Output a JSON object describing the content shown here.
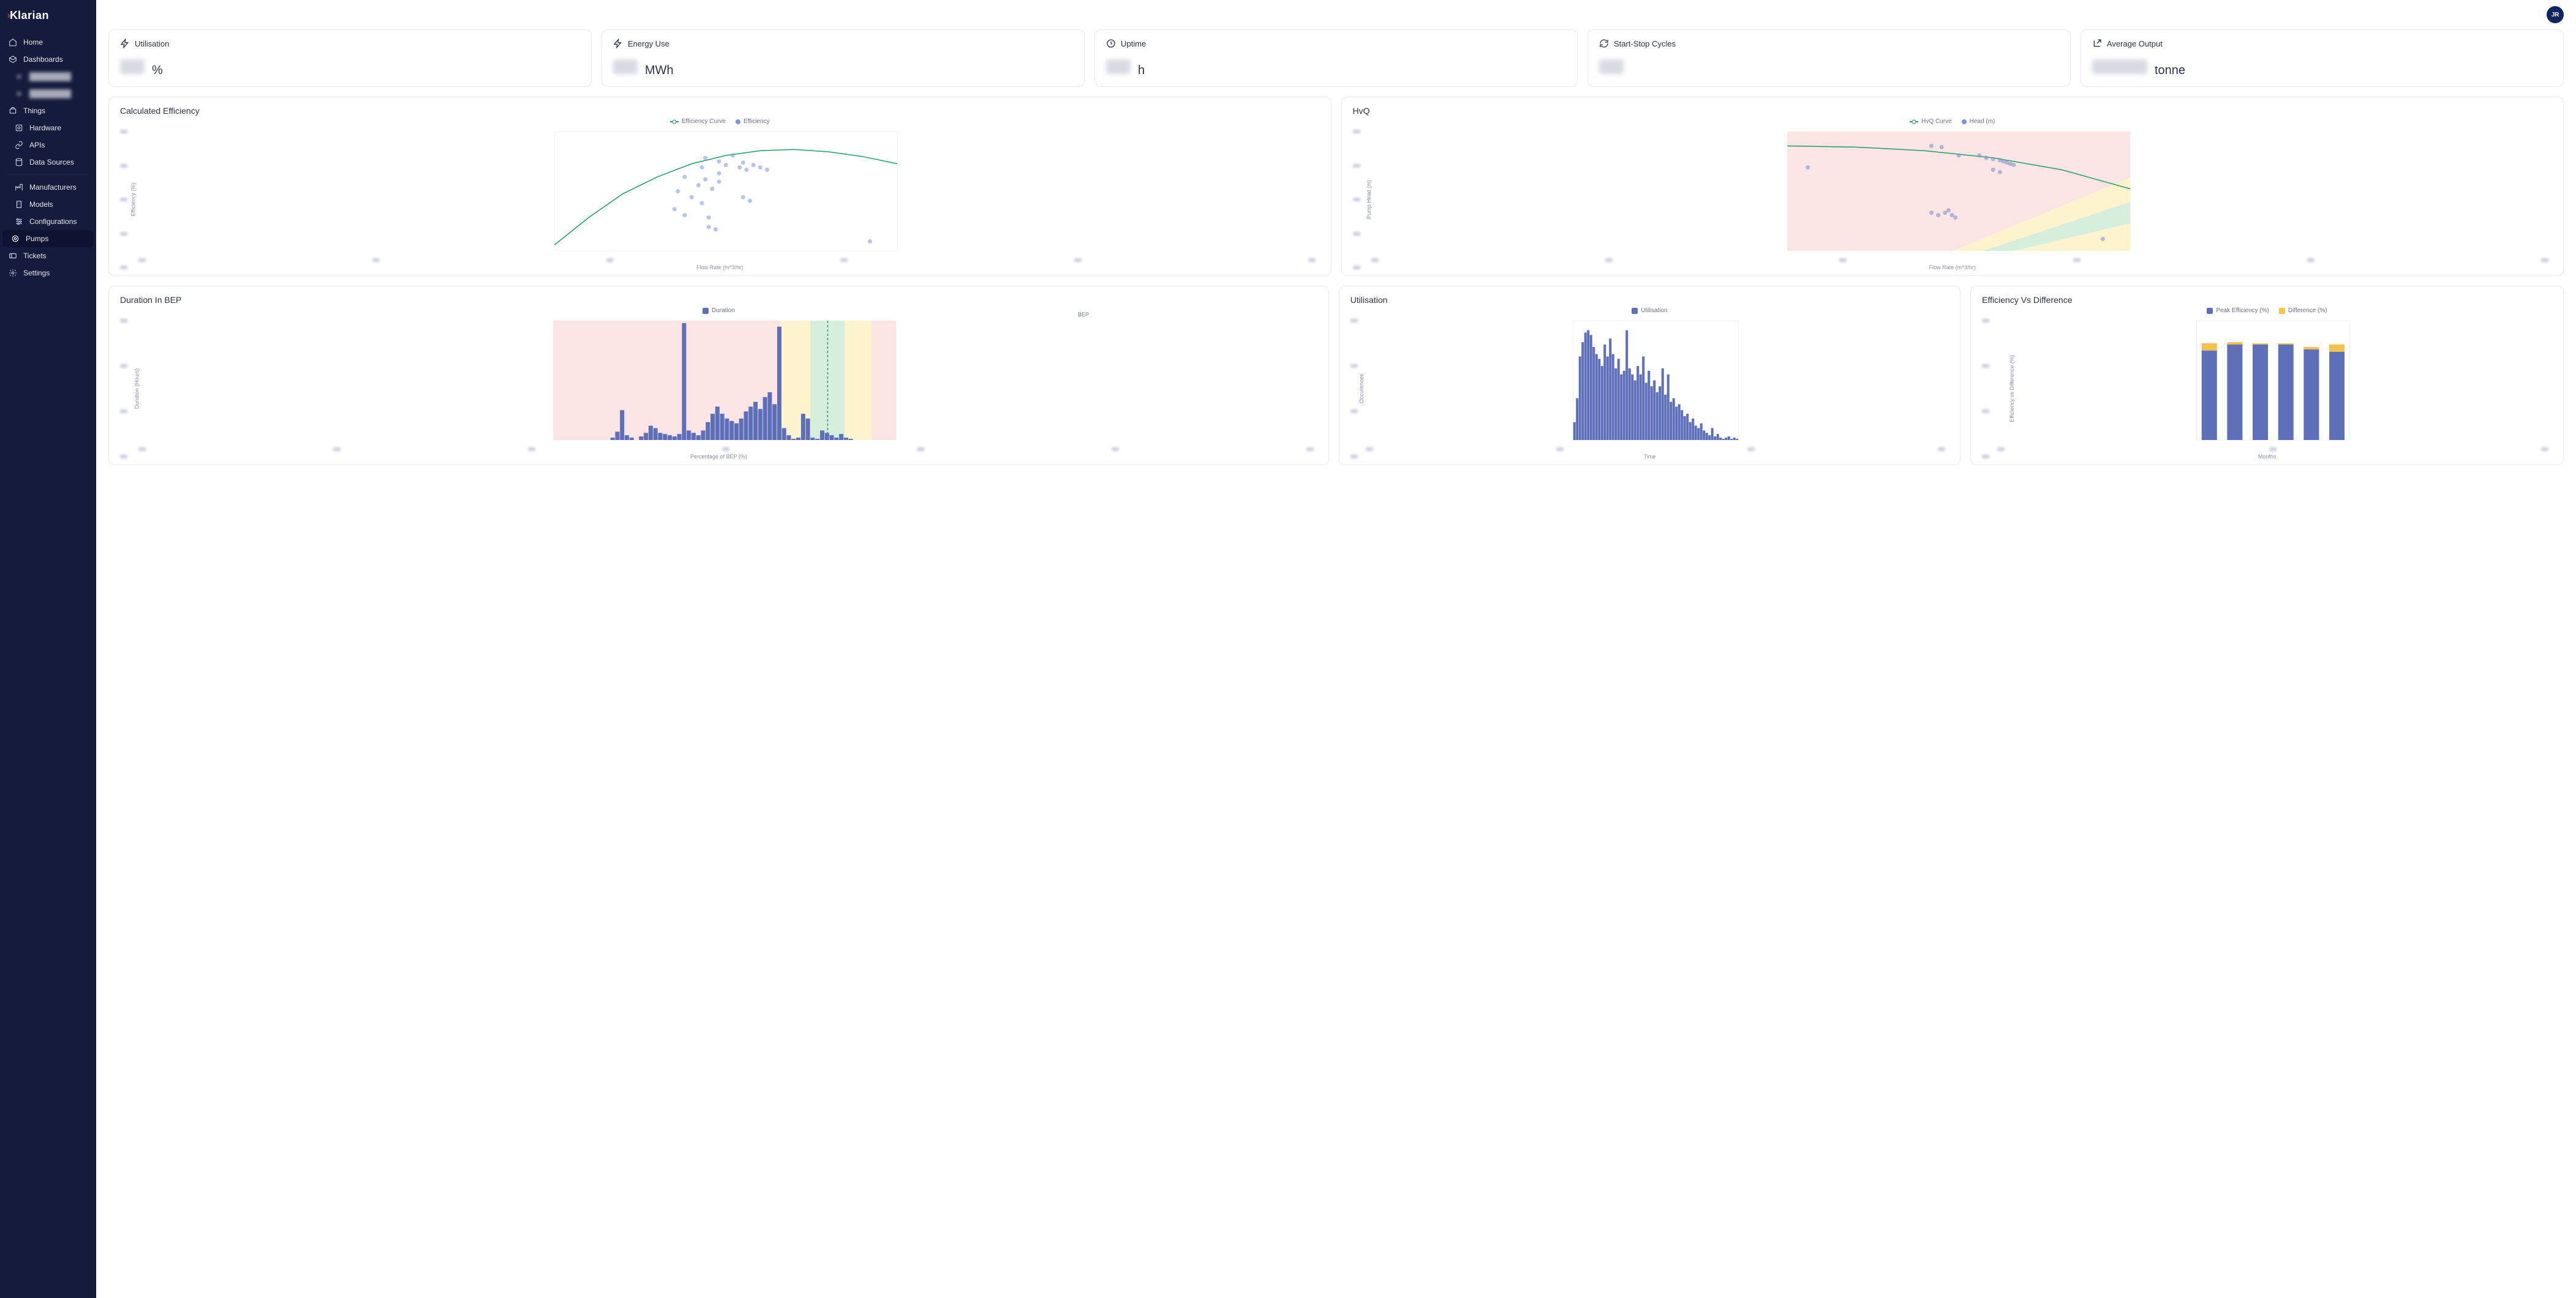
{
  "logo": "larian",
  "nav": {
    "home": "Home",
    "dashboards": "Dashboards",
    "things": "Things",
    "hardware": "Hardware",
    "apis": "APIs",
    "datasources": "Data Sources",
    "manufacturers": "Manufacturers",
    "models": "Models",
    "configurations": "Configurations",
    "pumps": "Pumps",
    "tickets": "Tickets",
    "settings": "Settings"
  },
  "avatar": "JR",
  "metrics": [
    {
      "label": "Utilisation",
      "unit": "%"
    },
    {
      "label": "Energy Use",
      "unit": "MWh"
    },
    {
      "label": "Uptime",
      "unit": "h"
    },
    {
      "label": "Start-Stop Cycles",
      "unit": ""
    },
    {
      "label": "Average Output",
      "unit": "tonne"
    }
  ],
  "charts": {
    "efficiency": {
      "title": "Calculated Efficiency",
      "legend": [
        "Efficiency Curve",
        "Efficiency"
      ],
      "xlabel": "Flow Rate (m^3/hr)",
      "ylabel": "Efficiency (%)"
    },
    "hvq": {
      "title": "HvQ",
      "legend": [
        "HvQ Curve",
        "Head (m)"
      ],
      "xlabel": "Flow Rate (m^3/hr)",
      "ylabel": "Pump Head (m)"
    },
    "bep": {
      "title": "Duration In BEP",
      "legend": [
        "Duration"
      ],
      "xlabel": "Percentage of BEP (%)",
      "ylabel": "Duration (Hours)",
      "marker": "BEP"
    },
    "util": {
      "title": "Utilisation",
      "legend": [
        "Utilisation"
      ],
      "xlabel": "Time",
      "ylabel": "Occurences"
    },
    "effdiff": {
      "title": "Efficiency Vs Difference",
      "legend": [
        "Peak Efficiency (%)",
        "Difference (%)"
      ],
      "xlabel": "Months",
      "ylabel": "Efficiency vs Difference (%)"
    }
  },
  "chart_data": [
    {
      "type": "scatter",
      "name": "Calculated Efficiency",
      "xlabel": "Flow Rate (m^3/hr)",
      "ylabel": "Efficiency (%)",
      "series": [
        {
          "name": "Efficiency Curve",
          "kind": "line",
          "x_norm": [
            0,
            0.1,
            0.2,
            0.3,
            0.4,
            0.5,
            0.6,
            0.7,
            0.8,
            0.9,
            1.0
          ],
          "y_norm": [
            0.05,
            0.28,
            0.48,
            0.62,
            0.73,
            0.8,
            0.84,
            0.85,
            0.83,
            0.79,
            0.73
          ]
        },
        {
          "name": "Efficiency",
          "kind": "scatter",
          "points_norm": [
            [
              0.35,
              0.35
            ],
            [
              0.36,
              0.5
            ],
            [
              0.38,
              0.62
            ],
            [
              0.38,
              0.3
            ],
            [
              0.4,
              0.45
            ],
            [
              0.42,
              0.55
            ],
            [
              0.43,
              0.7
            ],
            [
              0.43,
              0.4
            ],
            [
              0.44,
              0.78
            ],
            [
              0.44,
              0.6
            ],
            [
              0.45,
              0.28
            ],
            [
              0.46,
              0.52
            ],
            [
              0.48,
              0.65
            ],
            [
              0.48,
              0.75
            ],
            [
              0.48,
              0.58
            ],
            [
              0.5,
              0.72
            ],
            [
              0.52,
              0.8
            ],
            [
              0.54,
              0.7
            ],
            [
              0.55,
              0.74
            ],
            [
              0.56,
              0.68
            ],
            [
              0.58,
              0.72
            ],
            [
              0.6,
              0.7
            ],
            [
              0.62,
              0.68
            ],
            [
              0.55,
              0.45
            ],
            [
              0.57,
              0.42
            ],
            [
              0.45,
              0.2
            ],
            [
              0.47,
              0.18
            ],
            [
              0.92,
              0.08
            ]
          ]
        }
      ]
    },
    {
      "type": "scatter",
      "name": "HvQ",
      "xlabel": "Flow Rate (m^3/hr)",
      "ylabel": "Pump Head (m)",
      "bands": [
        {
          "name": "red",
          "x_start_norm": 0.0,
          "x_end_norm": 1.0
        },
        {
          "name": "green",
          "approx_slope": "diagonal"
        },
        {
          "name": "yellow",
          "approx_slope": "diagonal"
        }
      ],
      "series": [
        {
          "name": "HvQ Curve",
          "kind": "line",
          "x_norm": [
            0,
            0.2,
            0.4,
            0.6,
            0.8,
            1.0
          ],
          "y_norm": [
            0.88,
            0.87,
            0.84,
            0.78,
            0.68,
            0.52
          ]
        },
        {
          "name": "Head (m)",
          "kind": "scatter",
          "points_norm": [
            [
              0.42,
              0.88
            ],
            [
              0.45,
              0.87
            ],
            [
              0.06,
              0.7
            ],
            [
              0.42,
              0.32
            ],
            [
              0.44,
              0.3
            ],
            [
              0.46,
              0.32
            ],
            [
              0.47,
              0.34
            ],
            [
              0.48,
              0.3
            ],
            [
              0.49,
              0.28
            ],
            [
              0.5,
              0.8
            ],
            [
              0.56,
              0.8
            ],
            [
              0.58,
              0.78
            ],
            [
              0.6,
              0.77
            ],
            [
              0.62,
              0.76
            ],
            [
              0.63,
              0.75
            ],
            [
              0.64,
              0.74
            ],
            [
              0.65,
              0.73
            ],
            [
              0.66,
              0.72
            ],
            [
              0.6,
              0.68
            ],
            [
              0.62,
              0.66
            ],
            [
              0.92,
              0.1
            ]
          ]
        }
      ]
    },
    {
      "type": "bar",
      "name": "Duration In BEP",
      "xlabel": "Percentage of BEP (%)",
      "ylabel": "Duration (Hours)",
      "bep_marker_x_norm": 0.8,
      "bands": [
        {
          "name": "yellow_left",
          "x_norm": [
            0.66,
            0.75
          ]
        },
        {
          "name": "green",
          "x_norm": [
            0.75,
            0.85
          ]
        },
        {
          "name": "yellow_right",
          "x_norm": [
            0.85,
            0.93
          ]
        }
      ],
      "heights_norm": [
        0,
        0,
        0,
        0,
        0,
        0,
        0,
        0,
        0,
        0,
        0,
        0,
        0.02,
        0.07,
        0.25,
        0.04,
        0.02,
        0,
        0.03,
        0.06,
        0.12,
        0.1,
        0.06,
        0.05,
        0.04,
        0.03,
        0.05,
        0.98,
        0.08,
        0.06,
        0.04,
        0.08,
        0.15,
        0.22,
        0.28,
        0.22,
        0.18,
        0.16,
        0.14,
        0.18,
        0.24,
        0.28,
        0.32,
        0.26,
        0.36,
        0.4,
        0.3,
        0.95,
        0.1,
        0.04,
        0.01,
        0.02,
        0.22,
        0.18,
        0.02,
        0.01,
        0.08,
        0.06,
        0.04,
        0.02,
        0.05,
        0.02,
        0.01,
        0,
        0,
        0,
        0,
        0,
        0,
        0,
        0,
        0
      ]
    },
    {
      "type": "bar",
      "name": "Utilisation",
      "xlabel": "Time",
      "ylabel": "Occurences",
      "heights_norm": [
        0.15,
        0.35,
        0.7,
        0.82,
        0.9,
        0.92,
        0.88,
        0.78,
        0.72,
        0.68,
        0.62,
        0.8,
        0.7,
        0.85,
        0.72,
        0.6,
        0.68,
        0.55,
        0.58,
        0.92,
        0.6,
        0.55,
        0.5,
        0.62,
        0.55,
        0.7,
        0.48,
        0.58,
        0.45,
        0.5,
        0.4,
        0.45,
        0.6,
        0.38,
        0.55,
        0.32,
        0.35,
        0.28,
        0.3,
        0.25,
        0.2,
        0.22,
        0.15,
        0.18,
        0.12,
        0.1,
        0.14,
        0.08,
        0.06,
        0.04,
        0.1,
        0.03,
        0.05,
        0.02,
        0.01,
        0.02,
        0.03,
        0.01,
        0.02,
        0.01
      ]
    },
    {
      "type": "bar",
      "name": "Efficiency Vs Difference",
      "xlabel": "Months",
      "ylabel": "Efficiency vs Difference (%)",
      "categories": [
        "M1",
        "M2",
        "M3",
        "M4",
        "M5",
        "M6"
      ],
      "series": [
        {
          "name": "Peak Efficiency (%)",
          "values_norm": [
            0.75,
            0.8,
            0.8,
            0.8,
            0.76,
            0.74
          ]
        },
        {
          "name": "Difference (%)",
          "values_norm": [
            0.06,
            0.02,
            0.01,
            0.01,
            0.02,
            0.06
          ]
        }
      ]
    }
  ]
}
